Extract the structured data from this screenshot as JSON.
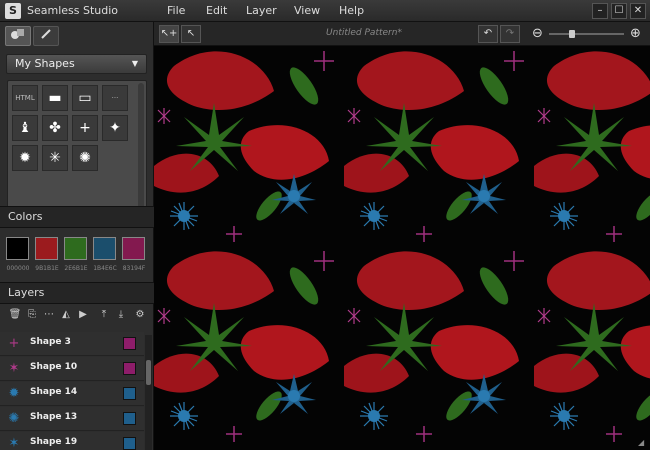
{
  "window": {
    "app_title": "Seamless Studio",
    "logo_text": "S",
    "controls": [
      "–",
      "☐",
      "✕"
    ]
  },
  "menu": [
    "File",
    "Edit",
    "Layer",
    "View",
    "Help"
  ],
  "toolbar": {
    "document_title": "Untitled Pattern*",
    "undo_icon": "↶",
    "redo_icon": "↷",
    "zoom_out_icon": "⊖",
    "zoom_in_icon": "⊕",
    "zoom_level_fraction": 0.3
  },
  "tools": {
    "shapes_tab_icon": "shapes-icon",
    "pencil_tab_icon": "pencil-icon",
    "add_tool_icon": "add-pointer-icon",
    "select_tool_icon": "pointer-icon"
  },
  "shapes_panel": {
    "dropdown_label": "My Shapes",
    "shapes": [
      {
        "glyph": "HTML",
        "small": true
      },
      {
        "glyph": "▬",
        "small": false
      },
      {
        "glyph": "▭",
        "small": false
      },
      {
        "glyph": "···",
        "small": true
      },
      {
        "glyph": "♝",
        "small": false
      },
      {
        "glyph": "✤",
        "small": false
      },
      {
        "glyph": "+",
        "small": false
      },
      {
        "glyph": "✦",
        "small": false
      },
      {
        "glyph": "✹",
        "small": false
      },
      {
        "glyph": "✳",
        "small": false
      },
      {
        "glyph": "✺",
        "small": false
      }
    ]
  },
  "colors": {
    "header": "Colors",
    "swatches": [
      {
        "hex": "#000000",
        "label": "000000"
      },
      {
        "hex": "#9B1B1E",
        "label": "9B1B1E"
      },
      {
        "hex": "#2E6B1E",
        "label": "2E6B1E"
      },
      {
        "hex": "#1B4E6C",
        "label": "1B4E6C"
      },
      {
        "hex": "#83194F",
        "label": "83194F"
      }
    ]
  },
  "layers": {
    "header": "Layers",
    "tools": [
      "🗑",
      "⎘",
      "⋯",
      "◭",
      "▶",
      "⤒",
      "⤓",
      "⚙"
    ],
    "items": [
      {
        "name": "Shape 3",
        "thumb": "+",
        "thumb_color": "#b03a8a",
        "color": "#8e1d6a"
      },
      {
        "name": "Shape 10",
        "thumb": "✶",
        "thumb_color": "#b03a8a",
        "color": "#8e1d6a"
      },
      {
        "name": "Shape 14",
        "thumb": "✹",
        "thumb_color": "#2a7ab0",
        "color": "#1f5f8c"
      },
      {
        "name": "Shape 13",
        "thumb": "✺",
        "thumb_color": "#2a7ab0",
        "color": "#1f5f8c"
      },
      {
        "name": "Shape 19",
        "thumb": "✶",
        "thumb_color": "#2a7ab0",
        "color": "#1f5f8c"
      }
    ]
  }
}
